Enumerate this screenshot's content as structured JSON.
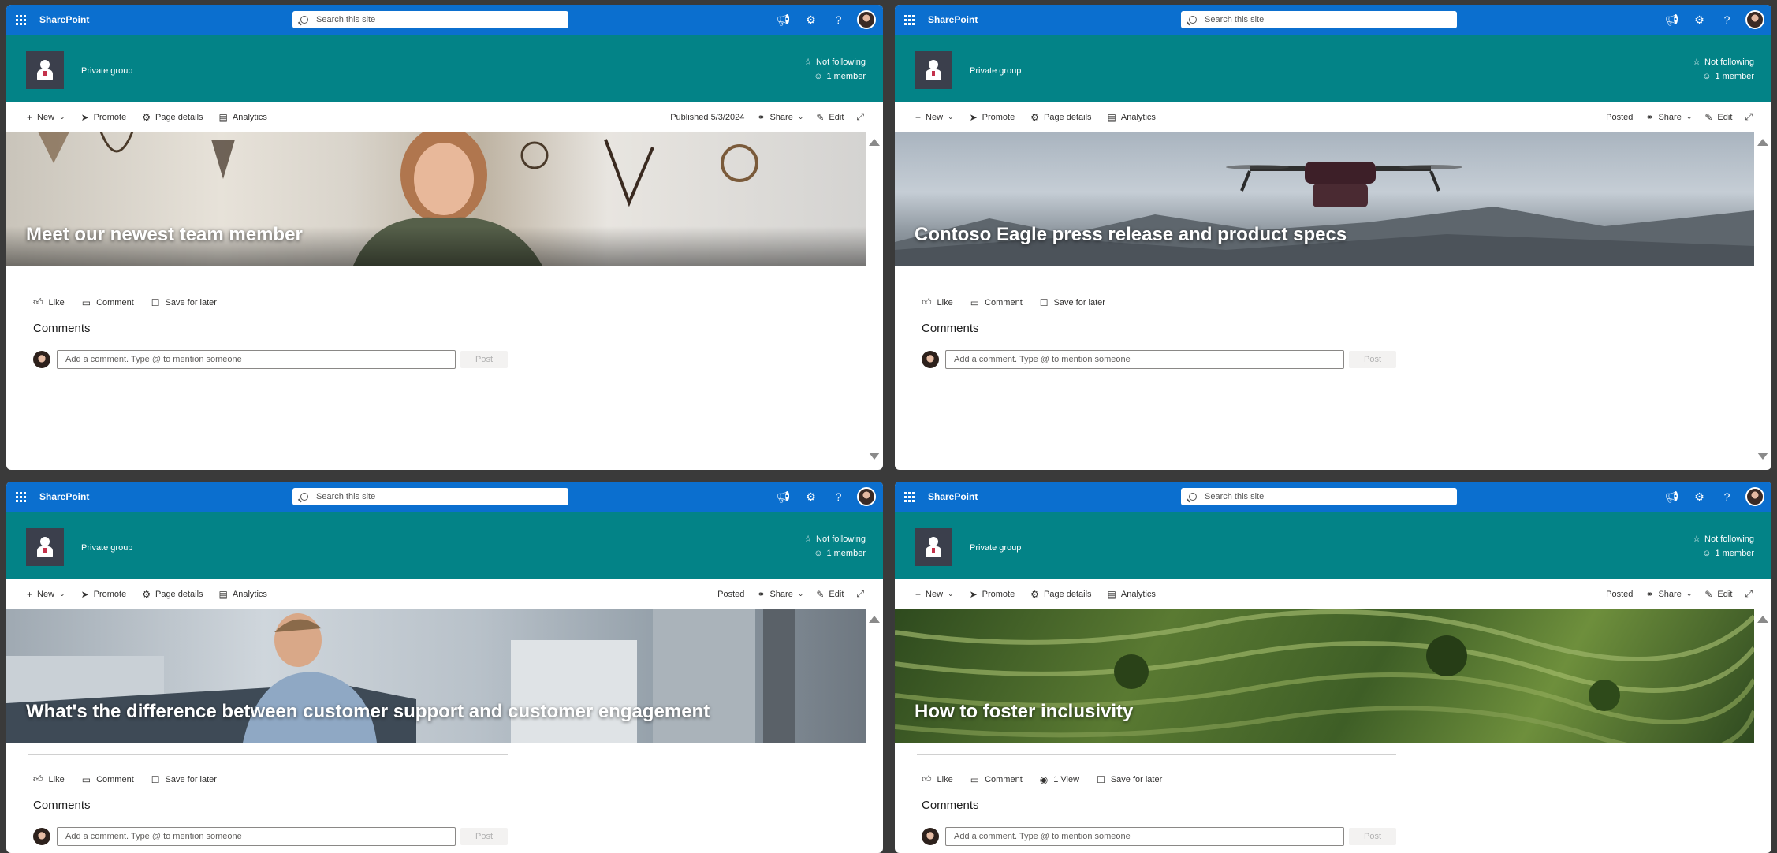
{
  "app": {
    "name": "SharePoint",
    "search_placeholder": "Search this site"
  },
  "site": {
    "group_label": "Private group",
    "follow_label": "Not following",
    "members_label": "1 member"
  },
  "commands": {
    "new": "New",
    "promote": "Promote",
    "page_details": "Page details",
    "analytics": "Analytics",
    "share": "Share",
    "edit": "Edit"
  },
  "social": {
    "like": "Like",
    "comment": "Comment",
    "save": "Save for later"
  },
  "comments": {
    "heading": "Comments",
    "placeholder": "Add a comment. Type @ to mention someone",
    "post": "Post"
  },
  "panes": [
    {
      "status": "Published 5/3/2024",
      "title": "Meet our newest team member",
      "views": ""
    },
    {
      "status": "Posted",
      "title": "Contoso Eagle press release and product specs",
      "views": ""
    },
    {
      "status": "Posted",
      "title": "What's the difference between customer support and customer engagement",
      "views": ""
    },
    {
      "status": "Posted",
      "title": "How to foster inclusivity",
      "views": "1 View"
    }
  ],
  "icons": [
    "waffle-icon",
    "search-icon",
    "megaphone-icon",
    "gear-icon",
    "help-icon",
    "star-icon",
    "person-icon",
    "plus-icon",
    "promote-icon",
    "page-details-icon",
    "analytics-icon",
    "share-icon",
    "edit-icon",
    "expand-icon",
    "like-icon",
    "comment-icon",
    "view-icon",
    "bookmark-icon"
  ],
  "colors": {
    "suite_bar": "#0b6fcf",
    "site_header": "#038387"
  }
}
